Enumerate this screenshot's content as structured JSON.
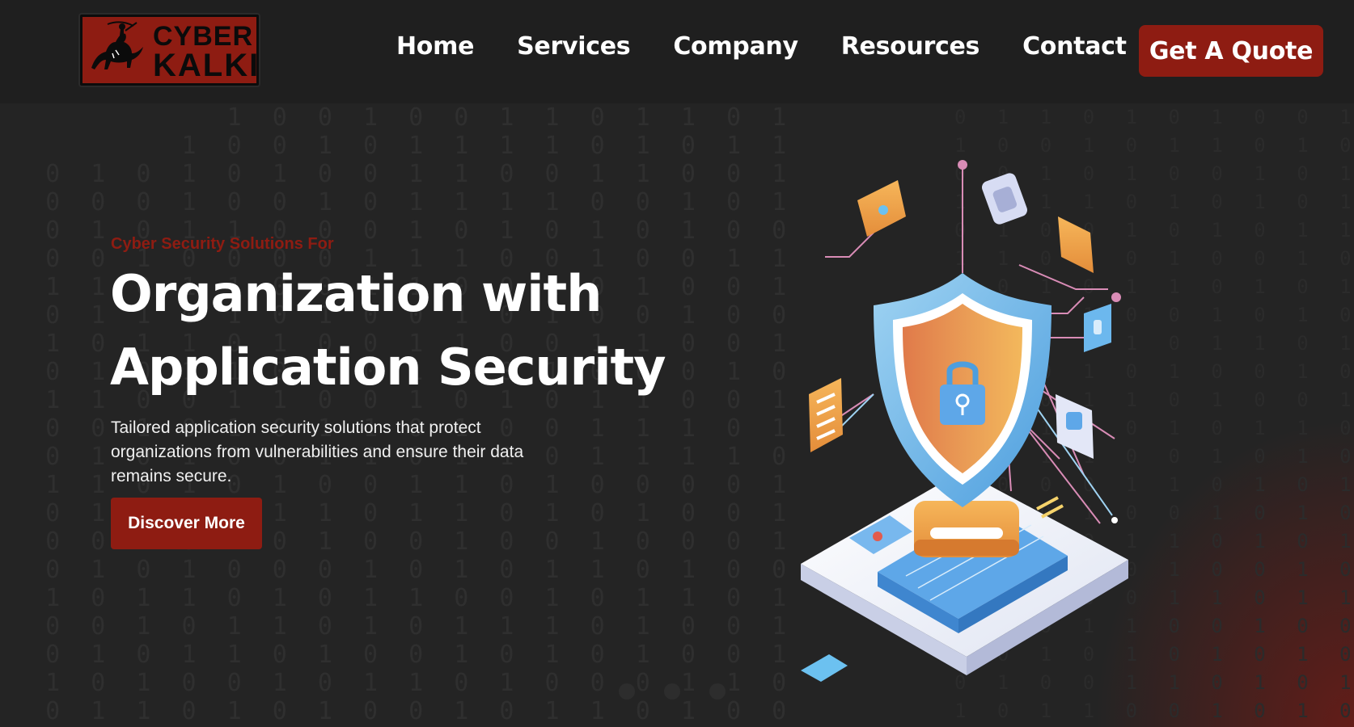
{
  "logo": {
    "line1": "CYBER",
    "line2": "KALKI"
  },
  "nav": {
    "items": [
      {
        "label": "Home"
      },
      {
        "label": "Services"
      },
      {
        "label": "Company"
      },
      {
        "label": "Resources"
      },
      {
        "label": "Contact"
      }
    ],
    "cta_label": "Get A Quote"
  },
  "hero": {
    "eyebrow": "Cyber Security Solutions For",
    "headline_line1": "Organization with",
    "headline_line2": "Application Security",
    "description": "Tailored application security solutions that protect organizations from vulnerabilities and ensure their data remains secure.",
    "button_label": "Discover More",
    "slider_dots": 3
  },
  "colors": {
    "accent": "#8e1c12",
    "header_bg": "#1f1f1f",
    "page_bg": "#242424"
  }
}
